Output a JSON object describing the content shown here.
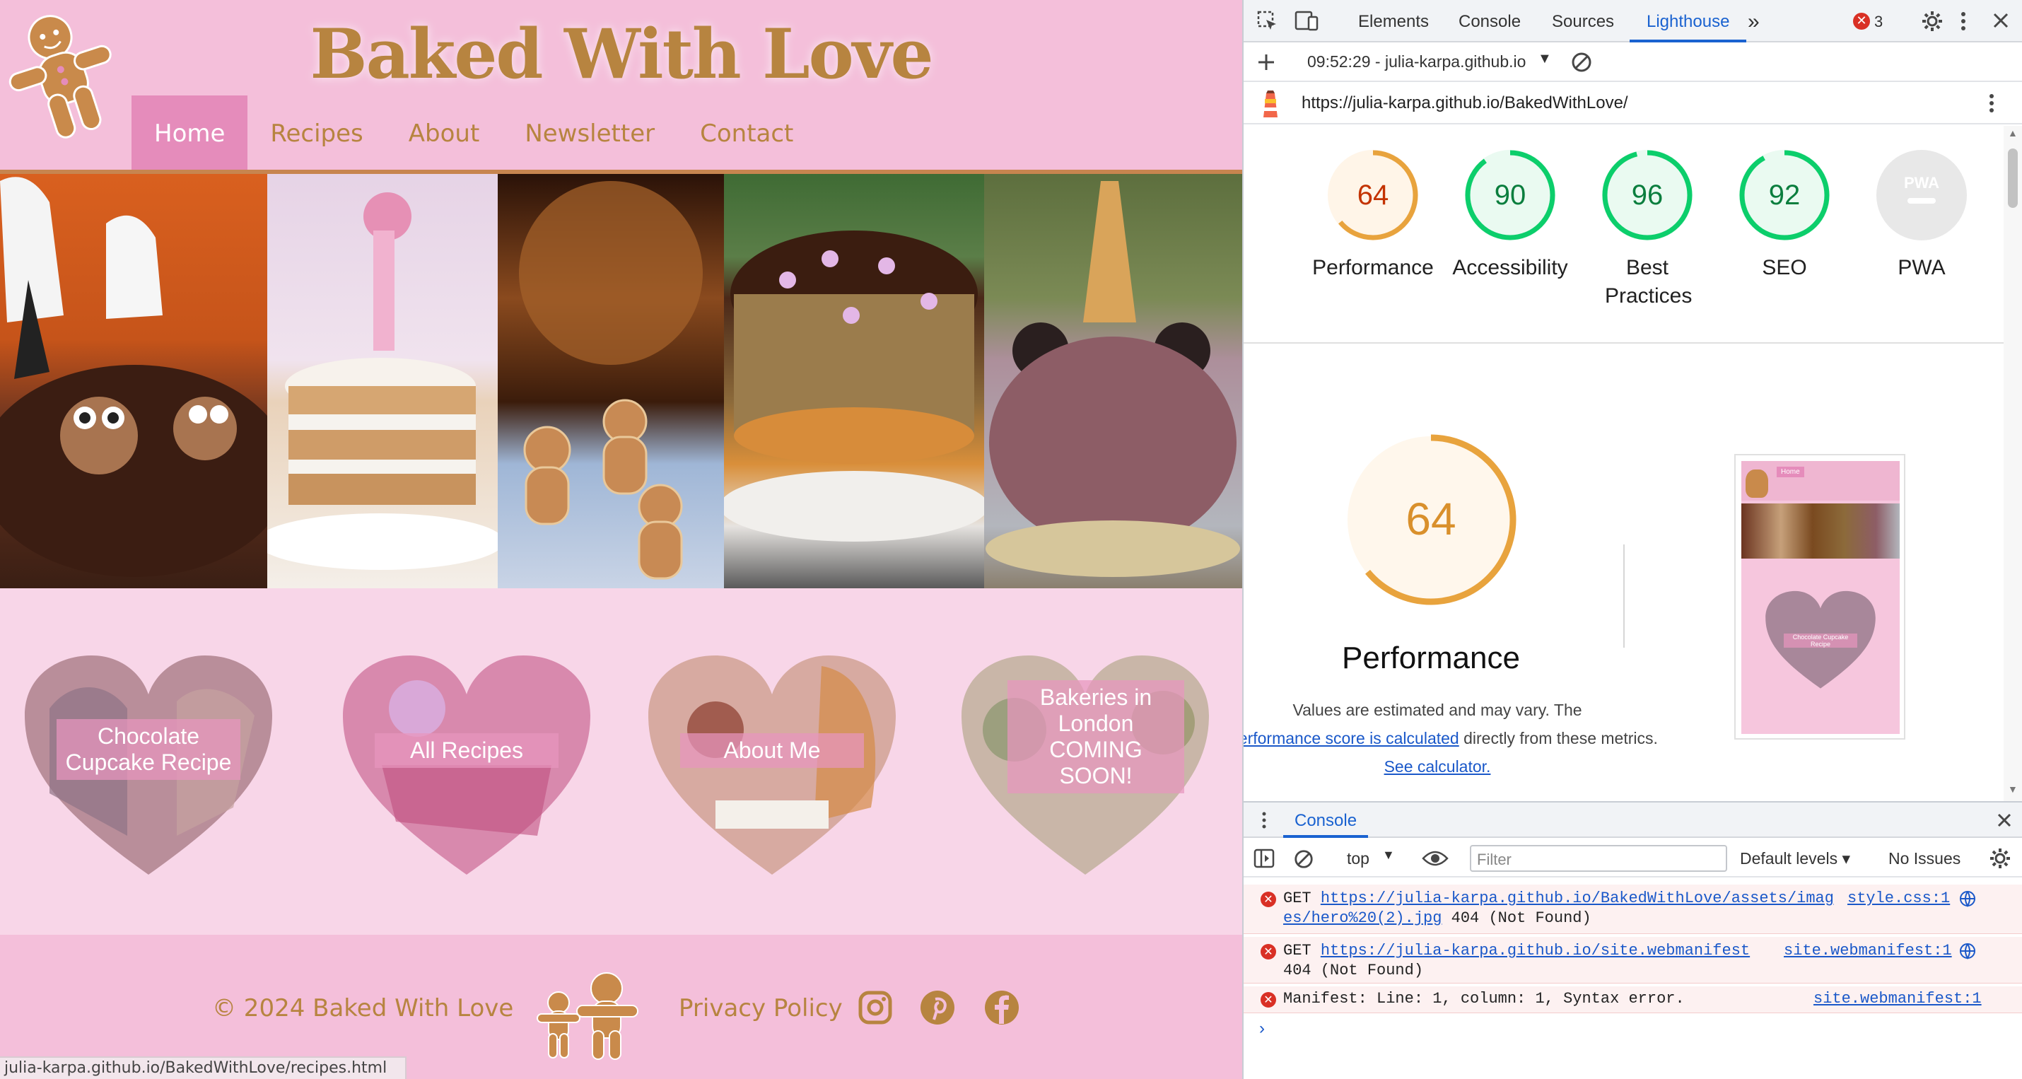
{
  "site": {
    "title": "Baked With Love",
    "nav": [
      {
        "label": "Home",
        "active": true
      },
      {
        "label": "Recipes",
        "active": false
      },
      {
        "label": "About",
        "active": false
      },
      {
        "label": "Newsletter",
        "active": false
      },
      {
        "label": "Contact",
        "active": false
      }
    ],
    "hearts": [
      {
        "label": "Chocolate Cupcake Recipe"
      },
      {
        "label": "All Recipes"
      },
      {
        "label": "About Me"
      },
      {
        "label": "Bakeries in London COMING SOON!"
      }
    ],
    "footer": {
      "copyright": "© 2024 Baked With Love",
      "privacy": "Privacy Policy"
    },
    "status_url": "julia-karpa.github.io/BakedWithLove/recipes.html",
    "colors": {
      "brand_gold": "#b78440",
      "pink_header": "#f4bfda",
      "pink_active": "#e58cbb"
    }
  },
  "devtools": {
    "tabs": [
      {
        "label": "Elements"
      },
      {
        "label": "Console"
      },
      {
        "label": "Sources"
      },
      {
        "label": "Lighthouse",
        "active": true
      }
    ],
    "error_count": "3",
    "lighthouse": {
      "report_selector": "09:52:29 - julia-karpa.github.io",
      "url": "https://julia-karpa.github.io/BakedWithLove/",
      "scores": [
        {
          "label": "Performance",
          "value": 64,
          "color": "#e8a33d"
        },
        {
          "label": "Accessibility",
          "value": 90,
          "color": "#0cce6b"
        },
        {
          "label": "Best Practices",
          "value": 96,
          "color": "#0cce6b"
        },
        {
          "label": "SEO",
          "value": 92,
          "color": "#0cce6b"
        },
        {
          "label": "PWA",
          "value": null,
          "color": "#9e9e9e"
        }
      ],
      "pwa_badge": "PWA",
      "big_score": 64,
      "big_label": "Performance",
      "note_part1": "Values are estimated and may vary. The",
      "note_link1": "performance score is calculated",
      "note_part2": "directly from these metrics.",
      "note_link2": "See calculator.",
      "thumbnail_label": "Chocolate Cupcake Recipe",
      "thumbnail_nav": "Home"
    },
    "console": {
      "title": "Console",
      "context": "top",
      "filter_placeholder": "Filter",
      "levels": "Default levels",
      "issues": "No Issues",
      "messages": [
        {
          "prefix": "GET",
          "url_line1": "https://julia-karpa.github.io/BakedWithLove/assets/imag",
          "url_line2": "es/hero%20(2).jpg",
          "status": "404 (Not Found)",
          "source": "style.css:1"
        },
        {
          "prefix": "GET",
          "url_line1": "https://julia-karpa.github.io/site.webmanifest",
          "url_line2": "",
          "status": "404 (Not Found)",
          "source": "site.webmanifest:1"
        },
        {
          "prefix": "",
          "text": "Manifest: Line: 1, column: 1, Syntax error.",
          "source": "site.webmanifest:1"
        }
      ]
    }
  }
}
